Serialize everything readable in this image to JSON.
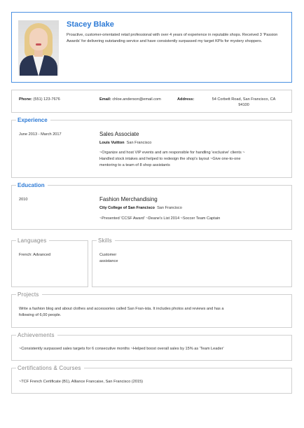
{
  "header": {
    "name": "Stacey Blake",
    "summary": "Proactive, customer-orientated retail professional with over 4 years of experience in reputable shops. Received 3 'Passion Awards' for delivering outstanding service and have consistently surpassed my target KPIs for mystery shoppers."
  },
  "contact": {
    "phone_label": "Phone:",
    "phone": "(551) 123-7676",
    "email_label": "Email:",
    "email": "chloe.anderson@email.com",
    "address_label": "Address:",
    "address_line1": "54 Corbett Road, San Francisco, CA",
    "address_line2": "94100"
  },
  "experience": {
    "title": "Experience",
    "date": "June 2013 - March 2017",
    "role": "Sales Associate",
    "company": "Louis Vuitton",
    "location": "San Francisco",
    "desc_lines": [
      "~Organize and host VIP events and am responsible for handling 'exclusive' clients ~",
      "Handled stock intakes and helped to redesign the shop's layout ~Give one-to-one",
      "mentoring to a team of 8 shop assistants"
    ]
  },
  "education": {
    "title": "Education",
    "date": "2010",
    "degree": "Fashion Merchandising",
    "school": "City College of San Francisco",
    "location": "San Francisco",
    "desc": "~Presented 'CCSF Award' ~Deane's List 2014 ~Soccer Team Captain"
  },
  "languages": {
    "title": "Languages",
    "item": "French: Advanced"
  },
  "skills": {
    "title": "Skills",
    "line1": "Customer",
    "line2": "assistance"
  },
  "projects": {
    "title": "Projects",
    "line1": "Write a fashion blog and about clothes and accessories called San Fran-ista. It includes photos and reviews and has a",
    "line2": "following of 6,00 people."
  },
  "achievements": {
    "title": "Achievements",
    "text": "~Consistently surpassed sales targets for 6 consecutive months ~Helped boost overall sales by 15% as 'Team Leader'"
  },
  "certifications": {
    "title": "Certifications & Courses",
    "text": "~TCF French Certificate (B1), Alliance Francaise, San Francisco (2015)"
  },
  "colors": {
    "accent": "#2e7bd6",
    "border": "#d0d0d0"
  }
}
